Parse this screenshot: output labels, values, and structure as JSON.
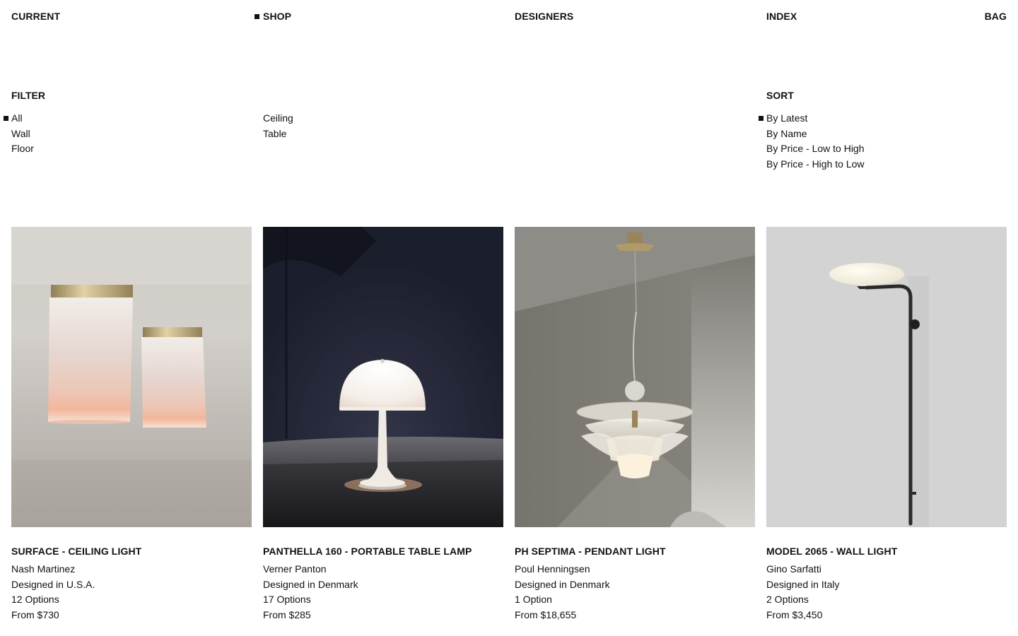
{
  "nav": {
    "current": "CURRENT",
    "shop": "SHOP",
    "designers": "DESIGNERS",
    "index": "INDEX",
    "bag": "BAG"
  },
  "filter": {
    "title": "FILTER",
    "options": [
      "All",
      "Wall",
      "Floor",
      "Ceiling",
      "Table"
    ],
    "selected": "All"
  },
  "sort": {
    "title": "SORT",
    "options": [
      "By Latest",
      "By Name",
      "By Price - Low to High",
      "By Price - High to Low"
    ],
    "selected": "By Latest"
  },
  "products": [
    {
      "title": "SURFACE - CEILING LIGHT",
      "designer": "Nash Martinez",
      "origin": "Designed in U.S.A.",
      "options": "12 Options",
      "price": "From $730"
    },
    {
      "title": "PANTHELLA 160 - PORTABLE TABLE LAMP",
      "designer": "Verner Panton",
      "origin": "Designed in Denmark",
      "options": "17 Options",
      "price": "From $285"
    },
    {
      "title": "PH SEPTIMA - PENDANT LIGHT",
      "designer": "Poul Henningsen",
      "origin": "Designed in Denmark",
      "options": "1 Option",
      "price": "From $18,655"
    },
    {
      "title": "MODEL 2065 - WALL LIGHT",
      "designer": "Gino Sarfatti",
      "origin": "Designed in Italy",
      "options": "2 Options",
      "price": "From $3,450"
    }
  ],
  "colors": {
    "text": "#111111",
    "background": "#ffffff"
  }
}
